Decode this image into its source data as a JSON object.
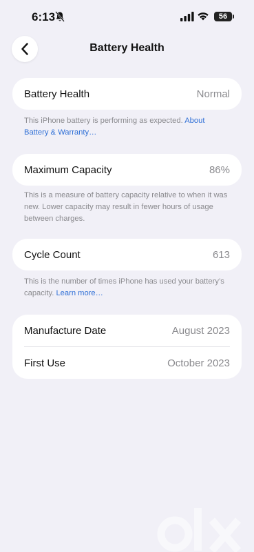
{
  "status": {
    "time": "6:13",
    "battery_level": "56"
  },
  "nav": {
    "title": "Battery Health"
  },
  "battery_health": {
    "label": "Battery Health",
    "value": "Normal",
    "footnote": "This iPhone battery is performing as expected.",
    "footnote_link": "About Battery & Warranty…"
  },
  "maximum_capacity": {
    "label": "Maximum Capacity",
    "value": "86%",
    "footnote": "This is a measure of battery capacity relative to when it was new. Lower capacity may result in fewer hours of usage between charges."
  },
  "cycle_count": {
    "label": "Cycle Count",
    "value": "613",
    "footnote": "This is the number of times iPhone has used your battery’s capacity.",
    "footnote_link": "Learn more…"
  },
  "dates": {
    "manufacture_label": "Manufacture Date",
    "manufacture_value": "August 2023",
    "first_use_label": "First Use",
    "first_use_value": "October 2023"
  },
  "colors": {
    "background": "#f1f0f7",
    "link": "#2f6fd6",
    "secondary_text": "#8a8a8e"
  }
}
